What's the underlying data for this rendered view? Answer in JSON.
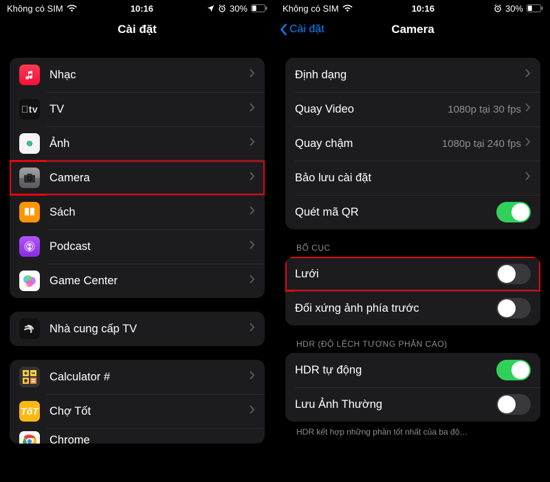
{
  "status": {
    "carrier": "Không có SIM",
    "time": "10:16",
    "battery_pct": "30%"
  },
  "left": {
    "title": "Cài đặt",
    "group1": [
      {
        "icon": "music-icon",
        "label": "Nhạc"
      },
      {
        "icon": "tv-icon",
        "label": "TV"
      },
      {
        "icon": "photos-icon",
        "label": "Ảnh"
      },
      {
        "icon": "camera-icon",
        "label": "Camera",
        "highlight": true
      },
      {
        "icon": "books-icon",
        "label": "Sách"
      },
      {
        "icon": "podcast-icon",
        "label": "Podcast"
      },
      {
        "icon": "gamecenter-icon",
        "label": "Game Center"
      }
    ],
    "group2": [
      {
        "icon": "tvprovider-icon",
        "label": "Nhà cung cấp TV"
      }
    ],
    "group3": [
      {
        "icon": "calculator-icon",
        "label": "Calculator #"
      },
      {
        "icon": "chotot-icon",
        "label": "Chợ Tốt"
      },
      {
        "icon": "chrome-icon",
        "label": "Chrome"
      }
    ]
  },
  "right": {
    "back": "Cài đặt",
    "title": "Camera",
    "group_top": {
      "format": {
        "label": "Định dạng"
      },
      "record_video": {
        "label": "Quay Video",
        "value": "1080p tại 30 fps"
      },
      "record_slomo": {
        "label": "Quay chậm",
        "value": "1080p tại 240 fps"
      },
      "preserve": {
        "label": "Bảo lưu cài đặt"
      },
      "scan_qr": {
        "label": "Quét mã QR",
        "on": true
      }
    },
    "section_layout": "BỐ CỤC",
    "group_layout": {
      "grid": {
        "label": "Lưới",
        "on": false,
        "highlight": true
      },
      "mirror_front": {
        "label": "Đối xứng ảnh phía trước",
        "on": false
      }
    },
    "section_hdr": "HDR (ĐỘ LỆCH TƯƠNG PHẢN CAO)",
    "group_hdr": {
      "auto_hdr": {
        "label": "HDR tự động",
        "on": true
      },
      "keep_normal": {
        "label": "Lưu Ảnh Thường",
        "on": false
      }
    },
    "footer": "HDR kết hợp những phần tốt nhất của ba độ…"
  }
}
